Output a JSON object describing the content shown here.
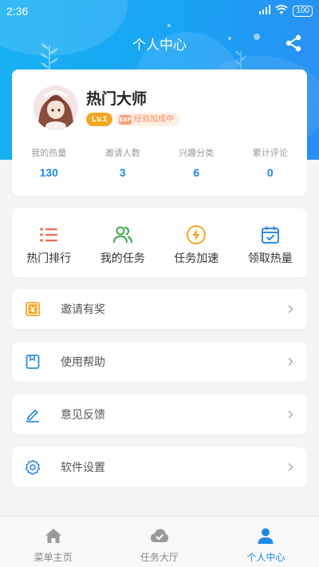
{
  "status_bar": {
    "time": "2:36",
    "battery": "100"
  },
  "header": {
    "title": "个人中心"
  },
  "profile": {
    "name": "热门大师",
    "level": "Lv.1",
    "exp_icon_text": "EXP",
    "exp_status": "经验加成中"
  },
  "stats": [
    {
      "label": "我的热量",
      "value": "130"
    },
    {
      "label": "邀请人数",
      "value": "3"
    },
    {
      "label": "兴趣分类",
      "value": "6"
    },
    {
      "label": "累计评论",
      "value": "0"
    }
  ],
  "shortcuts": [
    {
      "label": "热门排行",
      "icon": "list-icon",
      "color": "#f26b4f"
    },
    {
      "label": "我的任务",
      "icon": "users-icon",
      "color": "#3aa945"
    },
    {
      "label": "任务加速",
      "icon": "lightning-icon",
      "color": "#f5a623"
    },
    {
      "label": "领取热量",
      "icon": "calendar-check-icon",
      "color": "#2b8be6"
    }
  ],
  "menu": [
    {
      "label": "邀请有奖",
      "icon": "gift-voucher-icon",
      "color": "#f5a623"
    },
    {
      "label": "使用帮助",
      "icon": "book-icon",
      "color": "#2b8be6"
    },
    {
      "label": "意见反馈",
      "icon": "edit-icon",
      "color": "#2b8be6"
    },
    {
      "label": "软件设置",
      "icon": "gear-icon",
      "color": "#2b8be6"
    }
  ],
  "tabs": [
    {
      "label": "菜单主页",
      "icon": "home-icon",
      "active": false
    },
    {
      "label": "任务大厅",
      "icon": "cloud-check-icon",
      "active": false
    },
    {
      "label": "个人中心",
      "icon": "person-icon",
      "active": true
    }
  ],
  "colors": {
    "accent": "#1e88e5",
    "header_gradient_start": "#17b2f3",
    "header_gradient_end": "#2a8ef2"
  }
}
